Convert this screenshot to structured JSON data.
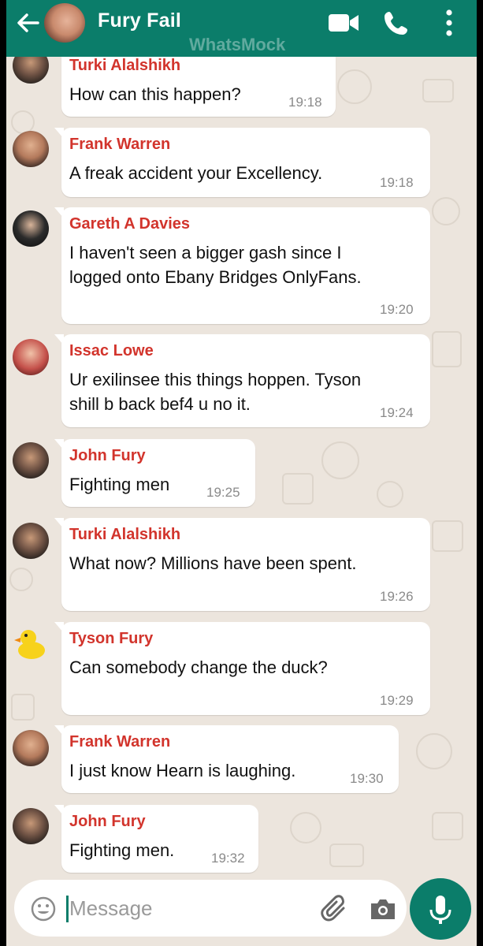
{
  "header": {
    "title": "Fury Fail",
    "watermark": "WhatsMock",
    "icons": {
      "back": "arrow-left-icon",
      "video": "video-camera-icon",
      "call": "phone-icon",
      "menu": "more-vert-icon"
    }
  },
  "messages": [
    {
      "sender": "Turki Alalshikh",
      "lines": [
        "How can this happen?"
      ],
      "time": "19:18",
      "avatar": "turki"
    },
    {
      "sender": "Frank Warren",
      "lines": [
        "A freak accident your Excellency."
      ],
      "time": "19:18",
      "avatar": "frank"
    },
    {
      "sender": "Gareth A Davies",
      "lines": [
        "I haven't seen a bigger gash since I",
        "logged onto Ebany Bridges OnlyFans."
      ],
      "time": "19:20",
      "avatar": "gareth"
    },
    {
      "sender": "Issac Lowe",
      "lines": [
        "Ur exilinsee this things hoppen. Tyson",
        "shill b back bef4 u no it."
      ],
      "time": "19:24",
      "avatar": "issac"
    },
    {
      "sender": "John Fury",
      "lines": [
        "Fighting men"
      ],
      "time": "19:25",
      "avatar": "john"
    },
    {
      "sender": "Turki Alalshikh",
      "lines": [
        "What now? Millions have been spent."
      ],
      "time": "19:26",
      "avatar": "turki"
    },
    {
      "sender": "Tyson Fury",
      "lines": [
        "Can somebody change the duck?"
      ],
      "time": "19:29",
      "avatar": "duck"
    },
    {
      "sender": "Frank Warren",
      "lines": [
        "I just know Hearn is laughing."
      ],
      "time": "19:30",
      "avatar": "frank"
    },
    {
      "sender": "John Fury",
      "lines": [
        "Fighting men."
      ],
      "time": "19:32",
      "avatar": "john"
    }
  ],
  "composer": {
    "placeholder": "Message",
    "value": "",
    "icons": {
      "emoji": "smiley-icon",
      "attach": "paperclip-icon",
      "camera": "camera-icon",
      "mic": "microphone-icon"
    }
  },
  "colors": {
    "header": "#0b7d6a",
    "sender": "#d2342c",
    "wallpaper": "#ece5dd",
    "bubble": "#ffffff"
  }
}
